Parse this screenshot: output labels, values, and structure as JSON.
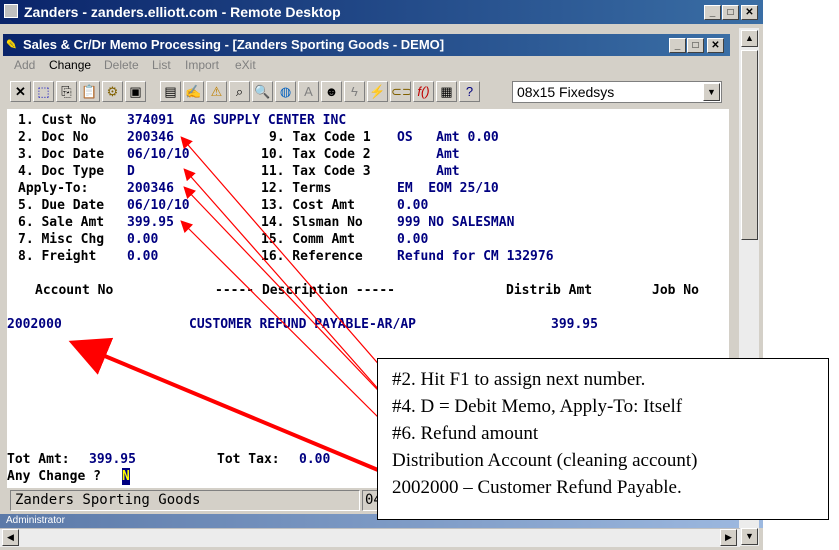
{
  "outer_window": {
    "title": "Zanders - zanders.elliott.com - Remote Desktop"
  },
  "app_window": {
    "title": "Sales & Cr/Dr Memo Processing - [Zanders Sporting Goods - DEMO]"
  },
  "menu": [
    {
      "label": "Add"
    },
    {
      "label": "Change"
    },
    {
      "label": "Delete"
    },
    {
      "label": "List"
    },
    {
      "label": "Import"
    },
    {
      "label": "eXit"
    }
  ],
  "toolbar": {
    "font_selector": "08x15 Fixedsys"
  },
  "form": {
    "lines": [
      {
        "label": "1. Cust No",
        "value": "374091  AG SUPPLY CENTER INC"
      },
      {
        "label": "2. Doc No",
        "value": "200346"
      },
      {
        "label": "3. Doc Date",
        "value": "06/10/10"
      },
      {
        "label": "4. Doc Type",
        "value": "D"
      },
      {
        "label": "Apply-To:",
        "value": "200346"
      },
      {
        "label": "5. Due Date",
        "value": "06/10/10"
      },
      {
        "label": "6. Sale Amt",
        "value": "399.95"
      },
      {
        "label": "7. Misc Chg",
        "value": "0.00"
      },
      {
        "label": "8. Freight",
        "value": "0.00"
      }
    ],
    "right_lines": [
      {
        "label": "9. Tax Code 1",
        "value": "OS   Amt 0.00"
      },
      {
        "label": "10. Tax Code 2",
        "value": "     Amt"
      },
      {
        "label": "11. Tax Code 3",
        "value": "     Amt"
      },
      {
        "label": "12. Terms",
        "value": "EM  EOM 25/10"
      },
      {
        "label": "13. Cost Amt",
        "value": "0.00"
      },
      {
        "label": "14. Slsman No",
        "value": "999 NO SALESMAN"
      },
      {
        "label": "15. Comm Amt",
        "value": "0.00"
      },
      {
        "label": "16. Reference",
        "value": "Refund for CM 132976"
      }
    ]
  },
  "distribution": {
    "headers": [
      "Account No",
      "----- Description -----",
      "Distrib Amt",
      "Job No"
    ],
    "rows": [
      {
        "account": "2002000",
        "description": "CUSTOMER REFUND PAYABLE-AR/AP",
        "amount": "399.95",
        "job": ""
      }
    ]
  },
  "totals": {
    "tot_amt_label": "Tot Amt:",
    "tot_amt": "399.95",
    "tot_tax_label": "Tot Tax:",
    "tot_tax": "0.00"
  },
  "prompt": {
    "text": "Any Change ?",
    "cursor_value": "N"
  },
  "status_bar": {
    "company": "Zanders Sporting Goods",
    "right_fragment": "04"
  },
  "taskbar": {
    "user": "Administrator"
  },
  "callout": {
    "lines": [
      "#2. Hit F1 to assign next number.",
      "#4. D = Debit Memo, Apply-To: Itself",
      "#6. Refund amount",
      "Distribution Account (cleaning account)",
      "2002000 – Customer Refund Payable."
    ]
  },
  "colors": {
    "arrow": "#ff0000",
    "title_bar": "#0a246a",
    "field_value": "#000080"
  }
}
